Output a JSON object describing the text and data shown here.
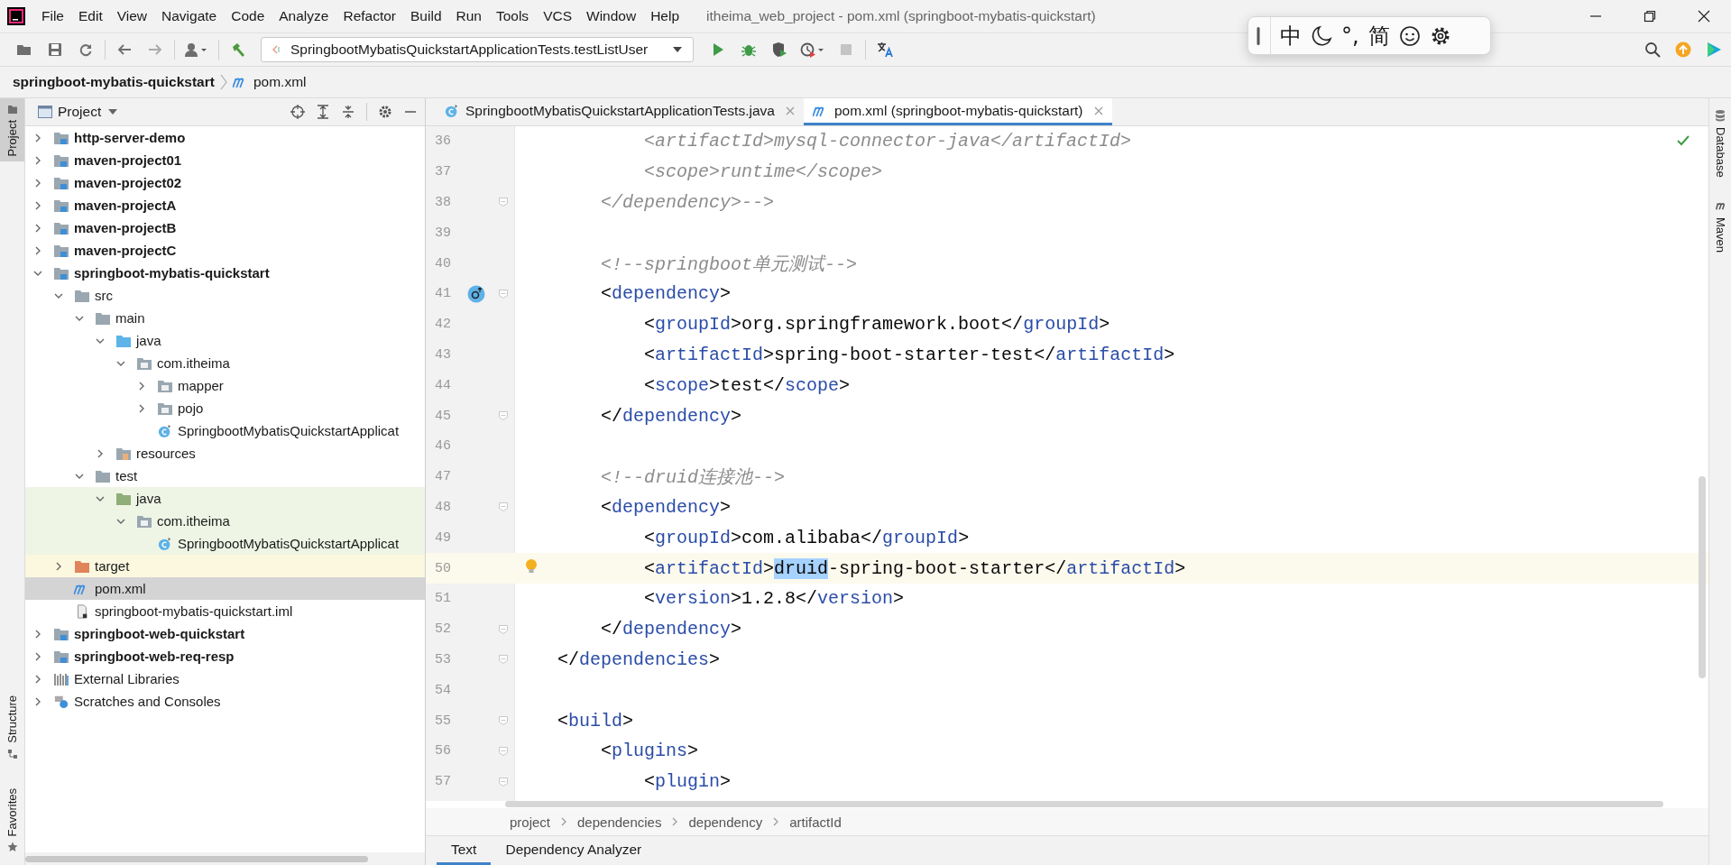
{
  "window": {
    "title": "itheima_web_project - pom.xml (springboot-mybatis-quickstart)"
  },
  "menu": [
    "File",
    "Edit",
    "View",
    "Navigate",
    "Code",
    "Analyze",
    "Refactor",
    "Build",
    "Run",
    "Tools",
    "VCS",
    "Window",
    "Help"
  ],
  "toolbar": {
    "run_config": "SpringbootMybatisQuickstartApplicationTests.testListUser"
  },
  "ime": {
    "mode": "中",
    "punctuation": "°,",
    "charset": "简"
  },
  "navbar": {
    "project": "springboot-mybatis-quickstart",
    "file": "pom.xml"
  },
  "left_stripe": {
    "top": [
      {
        "label": "Project",
        "kind": "project",
        "selected": true
      }
    ],
    "bottom": [
      {
        "label": "Structure",
        "kind": "structure",
        "selected": false
      },
      {
        "label": "Favorites",
        "kind": "favorites",
        "selected": false
      }
    ]
  },
  "right_stripe": [
    {
      "label": "Database",
      "kind": "database"
    },
    {
      "label": "Maven",
      "kind": "maven"
    }
  ],
  "project": {
    "title": "Project",
    "tree": [
      {
        "label": "http-server-demo",
        "kind": "module",
        "expanded": false,
        "selected": false
      },
      {
        "label": "maven-project01",
        "kind": "module",
        "expanded": false,
        "selected": false
      },
      {
        "label": "maven-project02",
        "kind": "module",
        "expanded": false,
        "selected": false
      },
      {
        "label": "maven-projectA",
        "kind": "module",
        "expanded": false,
        "selected": false
      },
      {
        "label": "maven-projectB",
        "kind": "module",
        "expanded": false,
        "selected": false
      },
      {
        "label": "maven-projectC",
        "kind": "module",
        "expanded": false,
        "selected": false
      },
      {
        "label": "springboot-mybatis-quickstart",
        "kind": "module",
        "expanded": true,
        "selected": false,
        "children": [
          {
            "label": "src",
            "kind": "folder",
            "expanded": true,
            "selected": false,
            "children": [
              {
                "label": "main",
                "kind": "folder",
                "expanded": true,
                "selected": false,
                "children": [
                  {
                    "label": "java",
                    "kind": "source",
                    "expanded": true,
                    "selected": false,
                    "children": [
                      {
                        "label": "com.itheima",
                        "kind": "package",
                        "expanded": true,
                        "selected": false,
                        "children": [
                          {
                            "label": "mapper",
                            "kind": "package",
                            "expanded": false,
                            "selected": false
                          },
                          {
                            "label": "pojo",
                            "kind": "package",
                            "expanded": false,
                            "selected": false
                          },
                          {
                            "label": "SpringbootMybatisQuickstartApplicat",
                            "kind": "app-class",
                            "selected": false
                          }
                        ]
                      }
                    ]
                  },
                  {
                    "label": "resources",
                    "kind": "resources",
                    "expanded": false,
                    "selected": false
                  }
                ]
              },
              {
                "label": "test",
                "kind": "folder",
                "expanded": true,
                "selected": false,
                "children": [
                  {
                    "label": "java",
                    "kind": "test-source",
                    "expanded": true,
                    "selected": false,
                    "test_scope": true,
                    "children": [
                      {
                        "label": "com.itheima",
                        "kind": "package",
                        "expanded": true,
                        "selected": false,
                        "test_scope": true,
                        "children": [
                          {
                            "label": "SpringbootMybatisQuickstartApplicat",
                            "kind": "test-class",
                            "selected": false,
                            "test_scope": true
                          }
                        ]
                      }
                    ]
                  }
                ]
              }
            ]
          },
          {
            "label": "target",
            "kind": "excluded",
            "expanded": false,
            "selected": false,
            "excluded": true
          },
          {
            "label": "pom.xml",
            "kind": "maven",
            "selected": true
          },
          {
            "label": "springboot-mybatis-quickstart.iml",
            "kind": "iml",
            "selected": false
          }
        ]
      },
      {
        "label": "springboot-web-quickstart",
        "kind": "module",
        "expanded": false,
        "selected": false
      },
      {
        "label": "springboot-web-req-resp",
        "kind": "module",
        "expanded": false,
        "selected": false
      },
      {
        "label": "External Libraries",
        "kind": "libraries",
        "expanded": false,
        "selected": false
      },
      {
        "label": "Scratches and Consoles",
        "kind": "scratches",
        "expanded": false,
        "selected": false
      }
    ]
  },
  "editor_tabs": [
    {
      "label": "SpringbootMybatisQuickstartApplicationTests.java",
      "kind": "test-class",
      "selected": false
    },
    {
      "label": "pom.xml (springboot-mybatis-quickstart)",
      "kind": "maven",
      "selected": true
    }
  ],
  "code_lines": [
    {
      "number": "36",
      "current": false,
      "fold": false,
      "segments": [
        {
          "kind": "comment",
          "text": "            <artifactId>mysql-connector-java</artifactId>"
        }
      ]
    },
    {
      "number": "37",
      "current": false,
      "fold": false,
      "segments": [
        {
          "kind": "comment",
          "text": "            <scope>runtime</scope>"
        }
      ]
    },
    {
      "number": "38",
      "current": false,
      "fold": true,
      "segments": [
        {
          "kind": "comment",
          "text": "        </dependency>-->"
        }
      ]
    },
    {
      "number": "39",
      "current": false,
      "fold": false
    },
    {
      "number": "40",
      "current": false,
      "fold": false,
      "segments": [
        {
          "kind": "comment",
          "text": "        <!--springboot单元测试-->"
        }
      ]
    },
    {
      "number": "41",
      "current": false,
      "fold": true,
      "override_marker": true,
      "segments": [
        {
          "kind": "punct",
          "text": "        <"
        },
        {
          "kind": "tag",
          "text": "dependency"
        },
        {
          "kind": "punct",
          "text": ">"
        }
      ]
    },
    {
      "number": "42",
      "current": false,
      "fold": false,
      "segments": [
        {
          "kind": "punct",
          "text": "            <"
        },
        {
          "kind": "tag",
          "text": "groupId"
        },
        {
          "kind": "punct",
          "text": ">"
        },
        {
          "kind": "text",
          "text": "org.springframework.boot"
        },
        {
          "kind": "punct",
          "text": "</"
        },
        {
          "kind": "tag",
          "text": "groupId"
        },
        {
          "kind": "punct",
          "text": ">"
        }
      ]
    },
    {
      "number": "43",
      "current": false,
      "fold": false,
      "segments": [
        {
          "kind": "punct",
          "text": "            <"
        },
        {
          "kind": "tag",
          "text": "artifactId"
        },
        {
          "kind": "punct",
          "text": ">"
        },
        {
          "kind": "text",
          "text": "spring-boot-starter-test"
        },
        {
          "kind": "punct",
          "text": "</"
        },
        {
          "kind": "tag",
          "text": "artifactId"
        },
        {
          "kind": "punct",
          "text": ">"
        }
      ]
    },
    {
      "number": "44",
      "current": false,
      "fold": false,
      "segments": [
        {
          "kind": "punct",
          "text": "            <"
        },
        {
          "kind": "tag",
          "text": "scope"
        },
        {
          "kind": "punct",
          "text": ">"
        },
        {
          "kind": "text",
          "text": "test"
        },
        {
          "kind": "punct",
          "text": "</"
        },
        {
          "kind": "tag",
          "text": "scope"
        },
        {
          "kind": "punct",
          "text": ">"
        }
      ]
    },
    {
      "number": "45",
      "current": false,
      "fold": true,
      "segments": [
        {
          "kind": "punct",
          "text": "        </"
        },
        {
          "kind": "tag",
          "text": "dependency"
        },
        {
          "kind": "punct",
          "text": ">"
        }
      ]
    },
    {
      "number": "46",
      "current": false,
      "fold": false
    },
    {
      "number": "47",
      "current": false,
      "fold": false,
      "segments": [
        {
          "kind": "comment",
          "text": "        <!--druid连接池-->"
        }
      ]
    },
    {
      "number": "48",
      "current": false,
      "fold": true,
      "segments": [
        {
          "kind": "punct",
          "text": "        <"
        },
        {
          "kind": "tag",
          "text": "dependency"
        },
        {
          "kind": "punct",
          "text": ">"
        }
      ]
    },
    {
      "number": "49",
      "current": false,
      "fold": false,
      "segments": [
        {
          "kind": "punct",
          "text": "            <"
        },
        {
          "kind": "tag",
          "text": "groupId"
        },
        {
          "kind": "punct",
          "text": ">"
        },
        {
          "kind": "text",
          "text": "com.alibaba"
        },
        {
          "kind": "punct",
          "text": "</"
        },
        {
          "kind": "tag",
          "text": "groupId"
        },
        {
          "kind": "punct",
          "text": ">"
        }
      ]
    },
    {
      "number": "50",
      "current": true,
      "fold": false,
      "intention_bulb": true,
      "segments": [
        {
          "kind": "punct",
          "text": "            <"
        },
        {
          "kind": "tag",
          "text": "artifactId"
        },
        {
          "kind": "punct",
          "text": ">"
        },
        {
          "kind": "selection",
          "text": "druid"
        },
        {
          "kind": "text",
          "text": "-spring-boot-starter"
        },
        {
          "kind": "punct",
          "text": "</"
        },
        {
          "kind": "tag",
          "text": "artifactId"
        },
        {
          "kind": "punct",
          "text": ">"
        }
      ]
    },
    {
      "number": "51",
      "current": false,
      "fold": false,
      "segments": [
        {
          "kind": "punct",
          "text": "            <"
        },
        {
          "kind": "tag",
          "text": "version"
        },
        {
          "kind": "punct",
          "text": ">"
        },
        {
          "kind": "text",
          "text": "1.2.8"
        },
        {
          "kind": "punct",
          "text": "</"
        },
        {
          "kind": "tag",
          "text": "version"
        },
        {
          "kind": "punct",
          "text": ">"
        }
      ]
    },
    {
      "number": "52",
      "current": false,
      "fold": true,
      "segments": [
        {
          "kind": "punct",
          "text": "        </"
        },
        {
          "kind": "tag",
          "text": "dependency"
        },
        {
          "kind": "punct",
          "text": ">"
        }
      ]
    },
    {
      "number": "53",
      "current": false,
      "fold": true,
      "segments": [
        {
          "kind": "punct",
          "text": "    </"
        },
        {
          "kind": "tag",
          "text": "dependencies"
        },
        {
          "kind": "punct",
          "text": ">"
        }
      ]
    },
    {
      "number": "54",
      "current": false,
      "fold": false
    },
    {
      "number": "55",
      "current": false,
      "fold": true,
      "segments": [
        {
          "kind": "punct",
          "text": "    <"
        },
        {
          "kind": "tag",
          "text": "build"
        },
        {
          "kind": "punct",
          "text": ">"
        }
      ]
    },
    {
      "number": "56",
      "current": false,
      "fold": true,
      "segments": [
        {
          "kind": "punct",
          "text": "        <"
        },
        {
          "kind": "tag",
          "text": "plugins"
        },
        {
          "kind": "punct",
          "text": ">"
        }
      ]
    },
    {
      "number": "57",
      "current": false,
      "fold": true,
      "segments": [
        {
          "kind": "punct",
          "text": "            <"
        },
        {
          "kind": "tag",
          "text": "plugin"
        },
        {
          "kind": "punct",
          "text": ">"
        }
      ]
    }
  ],
  "editor_breadcrumbs": [
    "project",
    "dependencies",
    "dependency",
    "artifactId"
  ],
  "bottom_tabs": [
    {
      "label": "Text",
      "selected": true
    },
    {
      "label": "Dependency Analyzer",
      "selected": false
    }
  ]
}
